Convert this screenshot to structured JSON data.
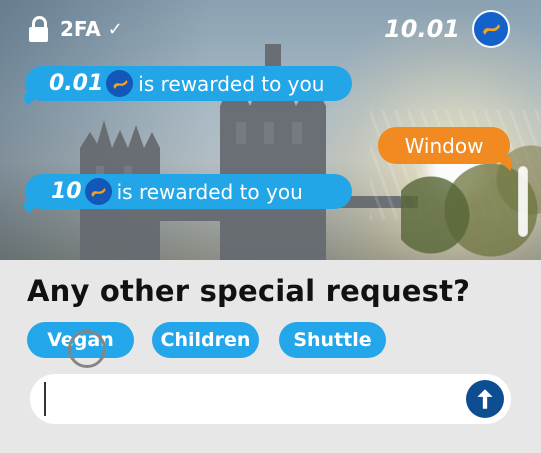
{
  "header": {
    "security_label": "2FA",
    "security_check": "✓",
    "balance": "10.01",
    "balance_icon": "coin-icon"
  },
  "chat": {
    "messages": [
      {
        "amount": "0.01",
        "text": "is rewarded to you"
      },
      {
        "text": "Window"
      },
      {
        "amount": "10",
        "text": "is rewarded to you"
      }
    ]
  },
  "prompt": {
    "question": "Any other special request?",
    "options": [
      "Vegan",
      "Children",
      "Shuttle"
    ]
  },
  "composer": {
    "value": "",
    "send_icon": "arrow-up-icon"
  },
  "colors": {
    "accent_blue": "#22a6e8",
    "accent_orange": "#f18a21",
    "send_button": "#0f4d92"
  }
}
